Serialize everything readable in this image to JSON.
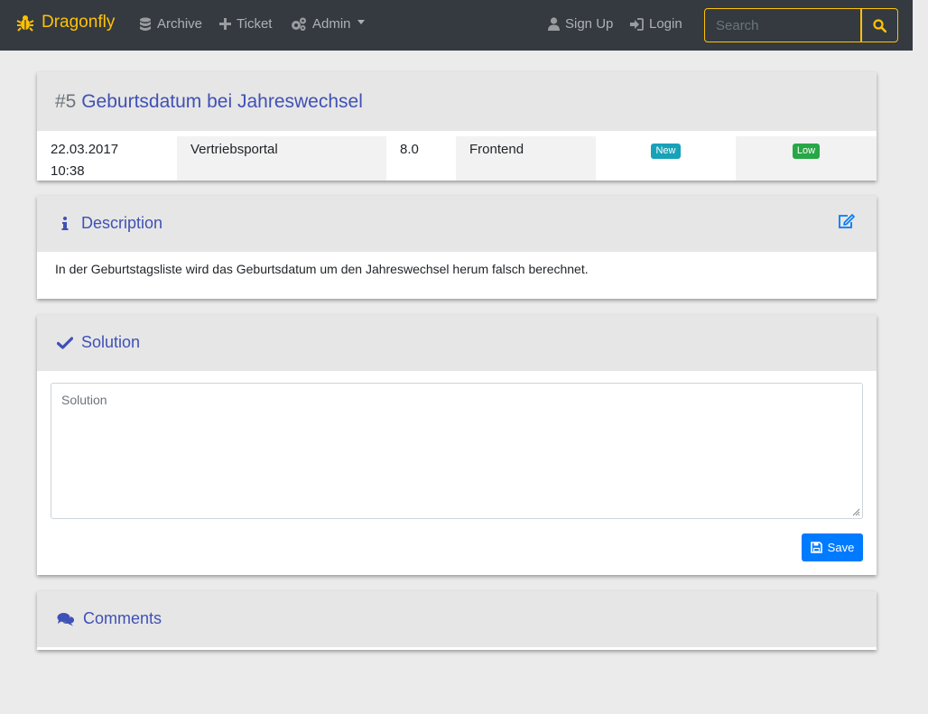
{
  "nav": {
    "brand": "Dragonfly",
    "archive": "Archive",
    "ticket": "Ticket",
    "admin": "Admin",
    "signup": "Sign Up",
    "login": "Login",
    "search_placeholder": "Search"
  },
  "ticket": {
    "number": "#5",
    "title": "Geburtsdatum bei Jahreswechsel",
    "date": "22.03.2017",
    "time": "10:38",
    "project": "Vertriebsportal",
    "version": "8.0",
    "component": "Frontend",
    "status": "New",
    "priority": "Low"
  },
  "description": {
    "heading": "Description",
    "text": "In der Geburtstagsliste wird das Geburtsdatum um den Jahreswechsel herum falsch berechnet."
  },
  "solution": {
    "heading": "Solution",
    "placeholder": "Solution",
    "save_label": "Save"
  },
  "comments": {
    "heading": "Comments"
  },
  "colors": {
    "brand": "#ffc107",
    "navbar": "#343a40",
    "heading": "#3f51b5",
    "status_new": "#17a2b8",
    "priority_low": "#28a745",
    "primary": "#007bff"
  }
}
